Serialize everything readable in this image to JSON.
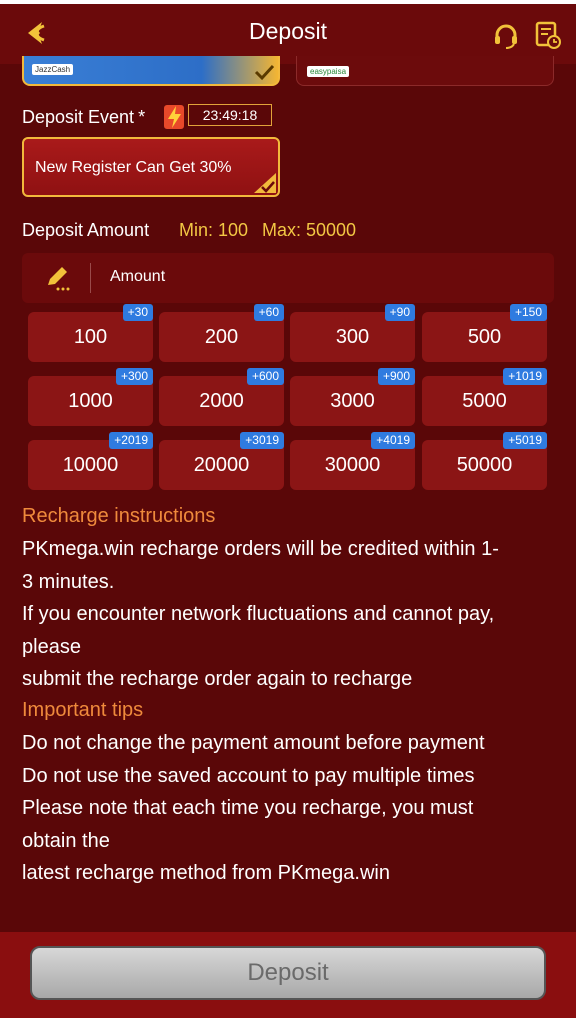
{
  "header": {
    "title": "Deposit"
  },
  "payment_methods": [
    {
      "brand": "JazzCash",
      "selected": true
    },
    {
      "brand": "easypaisa",
      "selected": false
    }
  ],
  "deposit_event": {
    "label": "Deposit Event",
    "required_mark": "*",
    "countdown": "23:49:18",
    "offer": "New Register Can Get 30%"
  },
  "deposit_amount": {
    "label": "Deposit Amount",
    "min": "Min: 100",
    "max": "Max: 50000",
    "input_placeholder": "Amount",
    "options": [
      {
        "value": "100",
        "bonus": "+30"
      },
      {
        "value": "200",
        "bonus": "+60"
      },
      {
        "value": "300",
        "bonus": "+90"
      },
      {
        "value": "500",
        "bonus": "+150"
      },
      {
        "value": "1000",
        "bonus": "+300"
      },
      {
        "value": "2000",
        "bonus": "+600"
      },
      {
        "value": "3000",
        "bonus": "+900"
      },
      {
        "value": "5000",
        "bonus": "+1019"
      },
      {
        "value": "10000",
        "bonus": "+2019"
      },
      {
        "value": "20000",
        "bonus": "+3019"
      },
      {
        "value": "30000",
        "bonus": "+4019"
      },
      {
        "value": "50000",
        "bonus": "+5019"
      }
    ]
  },
  "instructions": {
    "heading": "Recharge instructions",
    "lines": [
      "PKmega.win recharge orders will be credited within 1-",
      "3 minutes.",
      "If you encounter network fluctuations and cannot pay,",
      "please",
      "submit the recharge order again to recharge"
    ]
  },
  "tips": {
    "heading": "Important tips",
    "lines": [
      "Do not change the payment amount before payment",
      "Do not use the saved account to pay multiple times",
      "Please note that each time you recharge, you must",
      "obtain the",
      "latest recharge method from PKmega.win"
    ]
  },
  "footer": {
    "deposit_button": "Deposit"
  },
  "colors": {
    "background": "#5a0708",
    "accent_gold": "#f2b93c",
    "heading_orange": "#ef8a3c",
    "bonus_blue": "#2f7be0"
  }
}
